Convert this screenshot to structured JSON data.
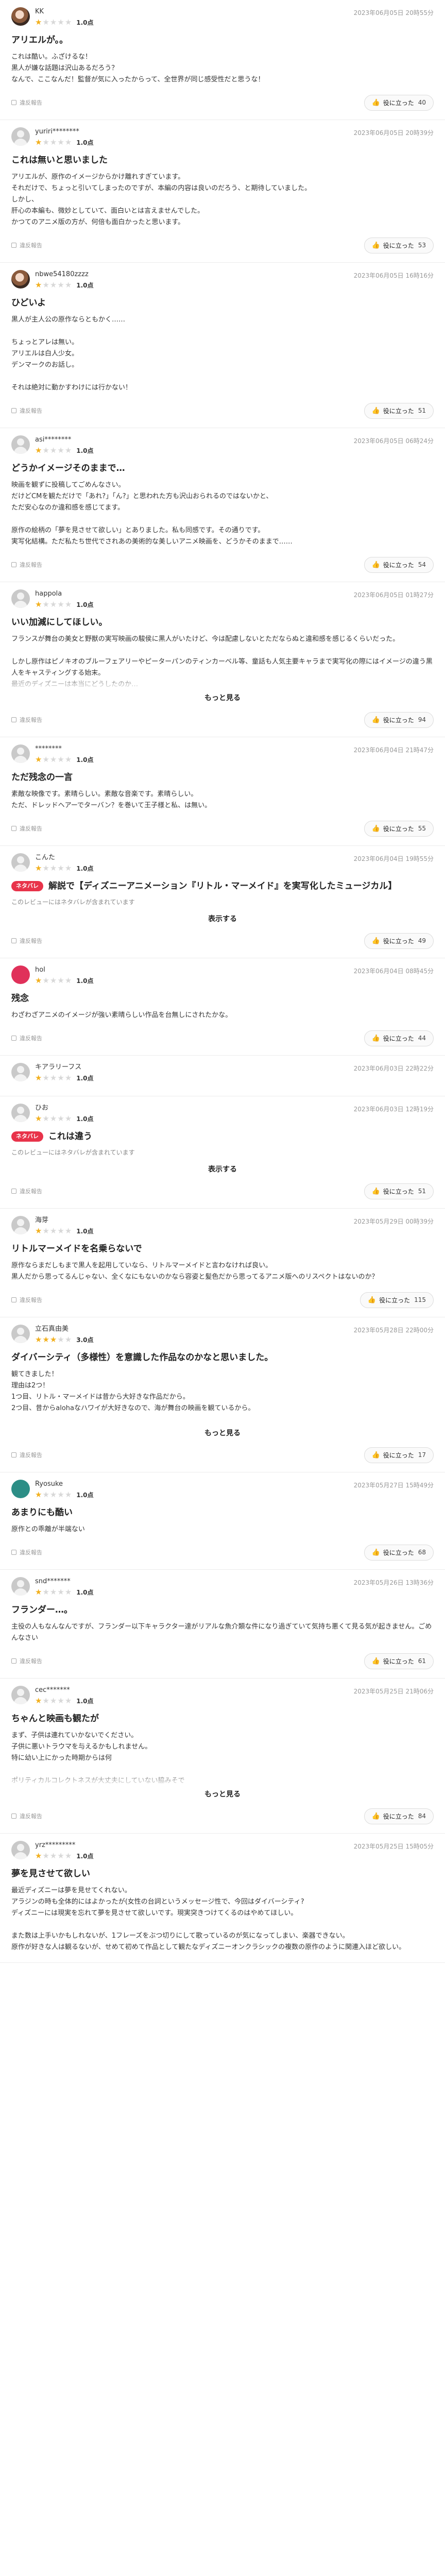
{
  "ui": {
    "report_label": "違反報告",
    "helpful_label": "役に立った",
    "read_more_label": "もっと見る",
    "show_label": "表示する",
    "spoiler_badge": "ネタバレ",
    "spoiler_note": "このレビューにはネタバレが含まれています",
    "helpful_icon": "👍"
  },
  "colors": {
    "star_on": "#f2b01e",
    "star_off": "#d8d8d8",
    "spoiler": "#e8334a"
  },
  "reviews": [
    {
      "user": "KK",
      "avatar": "photo",
      "rating": "1.0点",
      "stars": 1,
      "date": "2023年06月05日 20時55分",
      "title": "アリエルが。。",
      "body": "これは酷い。ふざけるな！\n黒人が嫌な話題は沢山あるだろう？\nなんで、ここなんだ！監督が気に入ったからって、全世界が同じ感受性だと思うな！",
      "clip": false,
      "spoiler": false,
      "helpful": "40"
    },
    {
      "user": "yuriri********",
      "avatar": "default",
      "rating": "1.0点",
      "stars": 1,
      "date": "2023年06月05日 20時39分",
      "title": "これは無いと思いました",
      "body": "アリエルが、原作のイメージからかけ離れすぎています。\nそれだけで、ちょっと引いてしまったのですが、本編の内容は良いのだろう、と期待していました。\nしかし、\n肝心の本編も、微妙としていて、面白いとは言えませんでした。\nかつてのアニメ版の方が、何倍も面白かったと思います。",
      "clip": false,
      "spoiler": false,
      "helpful": "53"
    },
    {
      "user": "nbwe54180zzzz",
      "avatar": "photo",
      "rating": "1.0点",
      "stars": 1,
      "date": "2023年06月05日 16時16分",
      "title": "ひどいよ",
      "body": "黒人が主人公の原作ならともかく……\n\nちょっとアレは無い。\nアリエルは白人少女。\nデンマークのお話し。\n\nそれは絶対に動かすわけには行かない！",
      "clip": false,
      "spoiler": false,
      "helpful": "51"
    },
    {
      "user": "asi********",
      "avatar": "default",
      "rating": "1.0点",
      "stars": 1,
      "date": "2023年06月05日 06時24分",
      "title": "どうかイメージそのままで…",
      "body": "映画を観ずに投稿してごめんなさい。\nだけどCMを観ただけで「あれ?」「ん?」と思われた方も沢山おられるのではないかと、\nただ安心なのか違和感を感じてます。\n\n原作の絵柄の「夢を見させて欲しい」とありました。私も同感です。その通りです。\n実写化結構。ただ私たち世代でされあの美術的な美しいアニメ映画を、どうかそのままで……",
      "clip": false,
      "spoiler": false,
      "helpful": "54"
    },
    {
      "user": "happola",
      "avatar": "default",
      "rating": "1.0点",
      "stars": 1,
      "date": "2023年06月05日 01時27分",
      "title": "いい加減にしてほしい。",
      "body": "フランスが舞台の美女と野獣の実写映画の駿侯に黒人がいたけど、今は配慮しないとただならぬと違和感を感じるくらいだった。\n\nしかし原作はピノキオのブルーフェアリーやピーターパンのティンカーベル等、童話も人気主要キャラまで実写化の際にはイメージの違う黒人をキャスティングする始末。\n最近のディズニーは本当にどうしたのか…",
      "clip": true,
      "spoiler": false,
      "helpful": "94"
    },
    {
      "user": "********",
      "avatar": "default",
      "rating": "1.0点",
      "stars": 1,
      "date": "2023年06月04日 21時47分",
      "title": "ただ残念の一言",
      "body": "素敵な映像です。素晴らしい。素敵な音楽です。素晴らしい。\nただ、ドレッドヘアーでターバン？を巻いて王子様と私、は無い。",
      "clip": false,
      "spoiler": false,
      "helpful": "55"
    },
    {
      "user": "こんた",
      "avatar": "default",
      "rating": "1.0点",
      "stars": 1,
      "date": "2023年06月04日 19時55分",
      "title": "解説で【ディズニーアニメーション『リトル・マーメイド』を実写化したミュージカル】",
      "body": "",
      "clip": false,
      "spoiler": true,
      "helpful": "49"
    },
    {
      "user": "hol",
      "avatar": "red",
      "rating": "1.0点",
      "stars": 1,
      "date": "2023年06月04日 08時45分",
      "title": "残念",
      "body": "わざわざアニメのイメージが強い素晴らしい作品を台無しにされたかな。",
      "clip": false,
      "spoiler": false,
      "helpful": "44"
    },
    {
      "user": "キアラリーフス",
      "avatar": "default",
      "rating": "1.0点",
      "stars": 1,
      "date": "2023年06月03日 22時22分",
      "title": "",
      "body": "",
      "clip": false,
      "spoiler": false,
      "helpful": ""
    },
    {
      "user": "ひお",
      "avatar": "default",
      "rating": "1.0点",
      "stars": 1,
      "date": "2023年06月03日 12時19分",
      "title": "これは違う",
      "body": "",
      "clip": false,
      "spoiler": true,
      "helpful": "51"
    },
    {
      "user": "海芽",
      "avatar": "default",
      "rating": "1.0点",
      "stars": 1,
      "date": "2023年05月29日 00時39分",
      "title": "リトルマーメイドを名乗らないで",
      "body": "原作ならまだしもまで黒人を起用していなら、リトルマーメイドと言わなければ良い。\n黒人だから思ってるんじゃない、全くなにもないのかなら容姿と髪色だから思ってるアニメ版へのリスペクトはないのか？",
      "clip": false,
      "spoiler": false,
      "helpful": "115"
    },
    {
      "user": "立石真由美",
      "avatar": "default",
      "rating": "3.0点",
      "stars": 3,
      "date": "2023年05月28日 22時00分",
      "title": "ダイバーシティ（多様性）を意識した作品なのかなと思いました。",
      "body": "観てきました！\n理由は2つ！\n1つ目、リトル・マーメイドは昔から大好きな作品だから。\n2つ目、昔からalohaなハワイが大好きなので、海が舞台の映画を観ているから。\n\n今回観る前から色々な意見を聞いていましたが、かえってそれが映画への興味へと…",
      "clip": true,
      "spoiler": false,
      "helpful": "17"
    },
    {
      "user": "Ryosuke",
      "avatar": "teal",
      "rating": "1.0点",
      "stars": 1,
      "date": "2023年05月27日 15時49分",
      "title": "あまりにも酷い",
      "body": "原作との乖離が半端ない",
      "clip": false,
      "spoiler": false,
      "helpful": "68"
    },
    {
      "user": "snd*******",
      "avatar": "default",
      "rating": "1.0点",
      "stars": 1,
      "date": "2023年05月26日 13時36分",
      "title": "フランダー…。",
      "body": "主役の人もなんなんですが、フランダー以下キャラクター達がリアルな魚介類な件になり過ぎていて気持ち悪くて見る気が起きません。ごめんなさい",
      "clip": false,
      "spoiler": false,
      "helpful": "61"
    },
    {
      "user": "cec*******",
      "avatar": "default",
      "rating": "1.0点",
      "stars": 1,
      "date": "2023年05月25日 21時06分",
      "title": "ちゃんと映画も観たが",
      "body": "まず、子供は連れていかないでください。\n子供に悪いトラウマを与えるかもしれません。\n特に幼い上にかった時期からは何\n\nポリティカルコレクトネスが大丈夫にしていない脇みそで\nいい映画が出来るわけがないと思うし\n今のディズニーの作品には夢も希望もありません…",
      "clip": true,
      "spoiler": false,
      "helpful": "84"
    },
    {
      "user": "yrz*********",
      "avatar": "default",
      "rating": "1.0点",
      "stars": 1,
      "date": "2023年05月25日 15時05分",
      "title": "夢を見させて欲しい",
      "body": "最近ディズニーは夢を見せてくれない。\nアラジンの時も全体的にはよかったが(女性の台詞というメッセージ性で、今回はダイバーシティ?\nディズニーには現実を忘れて夢を見させて欲しいです。現実突きつけてくるのはやめてほしい。\n\nまた数は上手いかもしれないが、1フレーズをぶつ切りにして歌っているのが気になってしまい、楽器できない。\n原作が好きな人は観るないが、せめて初めて作品として観たなディズニーオンクラシックの複数の原作のように関連入ほど欲しい。",
      "clip": false,
      "spoiler": false,
      "helpful": ""
    }
  ]
}
